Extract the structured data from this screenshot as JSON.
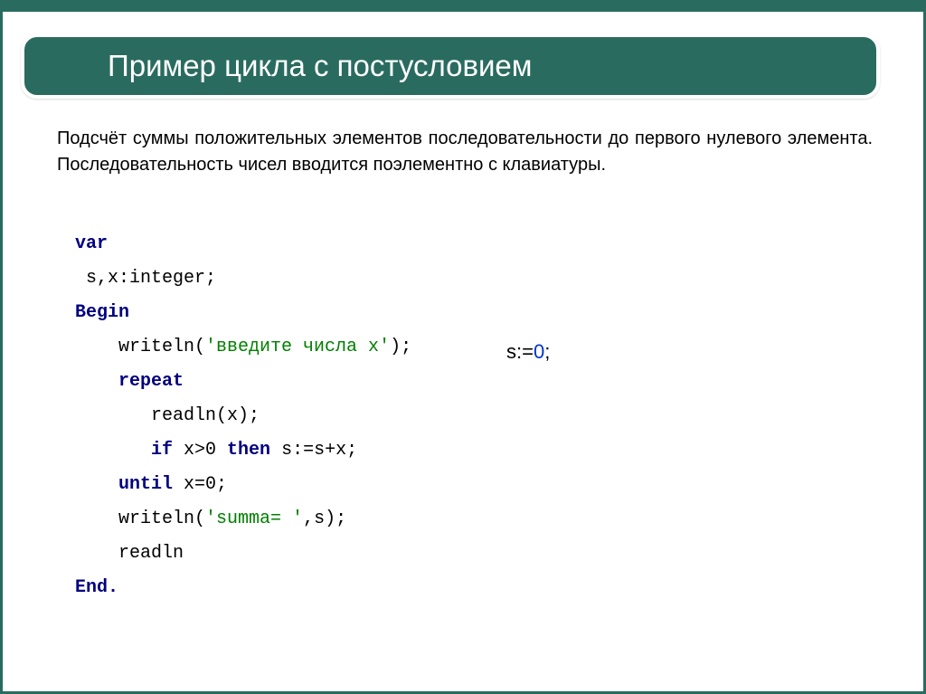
{
  "title": "Пример цикла с постусловием",
  "description": "Подсчёт суммы положительных элементов последовательности до первого нулевого элемента. Последовательность чисел вводится поэлементно с клавиатуры.",
  "code": {
    "l1_var": "var",
    "l2_decl": " s,x:integer;",
    "l3_begin": "Begin",
    "l4a": "    writeln(",
    "l4_str": "'введите числа x'",
    "l4b": ");",
    "l5_repeat": "    repeat",
    "l6_read": "       readln(x);",
    "l7a": "       ",
    "l7_if": "if",
    "l7b": " x>0 ",
    "l7_then": "then",
    "l7c": " s:=s+x;",
    "l8a": "    ",
    "l8_until": "until",
    "l8b": " x=0;",
    "l9a": "    writeln(",
    "l9_str": "'summa= '",
    "l9b": ",s);",
    "l10_readln": "    readln",
    "l11_end": "End."
  },
  "annotation": {
    "prefix": "s:=",
    "zero": "0",
    "suffix": ";"
  }
}
